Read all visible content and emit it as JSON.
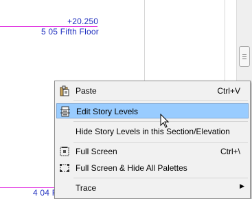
{
  "levels": {
    "upper": {
      "elevation": "+20.250",
      "name": "5 05 Fifth Floor"
    },
    "lower": {
      "name": "4 04 F"
    }
  },
  "colors": {
    "level_line": "#e23de2",
    "level_text": "#1f2fbf",
    "highlight": "#99ccff"
  },
  "context_menu": {
    "items": [
      {
        "label": "Paste",
        "shortcut": "Ctrl+V",
        "icon": "paste-icon"
      },
      {
        "label": "Edit Story Levels",
        "shortcut": "",
        "icon": "story-levels-icon",
        "highlighted": true
      },
      {
        "label": "Hide Story Levels in this Section/Elevation",
        "shortcut": ""
      },
      {
        "label": "Full Screen",
        "shortcut": "Ctrl+\\",
        "icon": "full-screen-icon"
      },
      {
        "label": "Full Screen & Hide All Palettes",
        "shortcut": "",
        "icon": "full-screen-hide-palettes-icon"
      },
      {
        "label": "Trace",
        "shortcut": "",
        "submenu": true
      }
    ]
  }
}
